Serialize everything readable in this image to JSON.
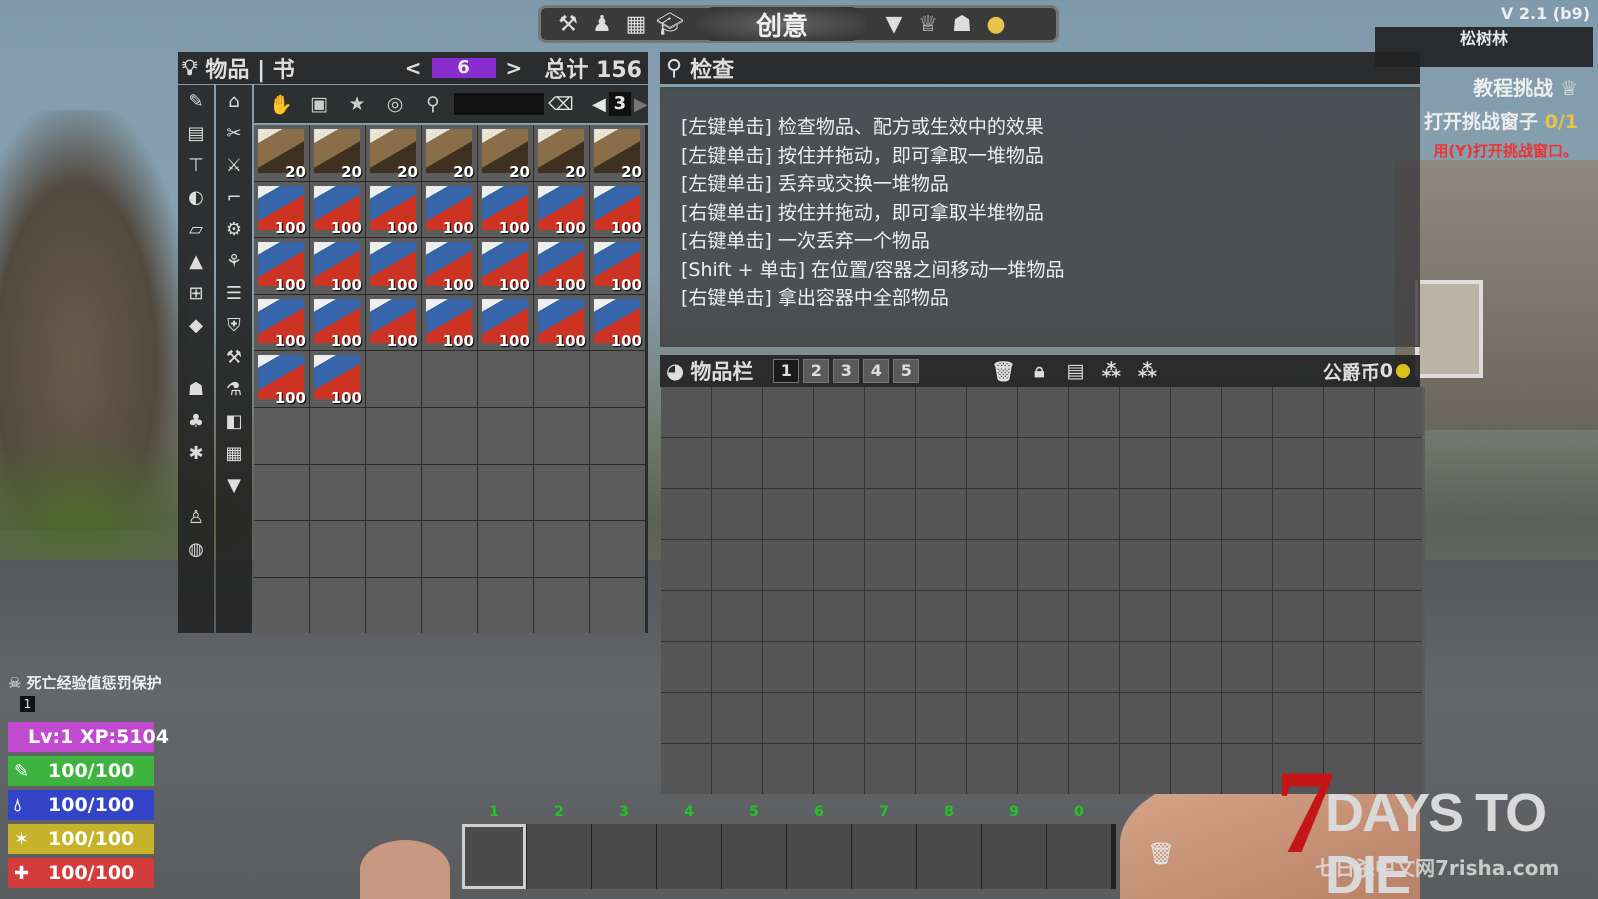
{
  "top_toolbar": {
    "mode_label": "创意",
    "left_icons": [
      "crafting-hammer-icon",
      "character-icon",
      "map-icon",
      "skills-icon"
    ],
    "right_icons": [
      "challenges-icon",
      "trophy-icon",
      "players-icon",
      "quest-bulb-icon"
    ]
  },
  "version": "V 2.1 (b9)",
  "biome": "松树林",
  "challenge": {
    "title": "教程挑战",
    "objective_prefix": "打开挑战窗子",
    "progress": "0/1",
    "hint": "用(Y)打开挑战窗口。"
  },
  "inventory": {
    "title": "物品 | 书",
    "page": "6",
    "total": "总计 156",
    "subpage": "3",
    "prev": "<",
    "next": ">",
    "items": [
      {
        "count": "20",
        "style": "a"
      },
      {
        "count": "20",
        "style": "a"
      },
      {
        "count": "20",
        "style": "a"
      },
      {
        "count": "20",
        "style": "a"
      },
      {
        "count": "20",
        "style": "a"
      },
      {
        "count": "20",
        "style": "a"
      },
      {
        "count": "20",
        "style": "a"
      },
      {
        "count": "100",
        "style": "b"
      },
      {
        "count": "100",
        "style": "b"
      },
      {
        "count": "100",
        "style": "b"
      },
      {
        "count": "100",
        "style": "b"
      },
      {
        "count": "100",
        "style": "b"
      },
      {
        "count": "100",
        "style": "b"
      },
      {
        "count": "100",
        "style": "b"
      },
      {
        "count": "100",
        "style": "b"
      },
      {
        "count": "100",
        "style": "b"
      },
      {
        "count": "100",
        "style": "b"
      },
      {
        "count": "100",
        "style": "b"
      },
      {
        "count": "100",
        "style": "b"
      },
      {
        "count": "100",
        "style": "b"
      },
      {
        "count": "100",
        "style": "b"
      },
      {
        "count": "100",
        "style": "b"
      },
      {
        "count": "100",
        "style": "b"
      },
      {
        "count": "100",
        "style": "b"
      },
      {
        "count": "100",
        "style": "b"
      },
      {
        "count": "100",
        "style": "b"
      },
      {
        "count": "100",
        "style": "b"
      },
      {
        "count": "100",
        "style": "b"
      },
      {
        "count": "100",
        "style": "b"
      },
      {
        "count": "100",
        "style": "b"
      }
    ],
    "total_cells": 63
  },
  "inspect": {
    "title": "检查",
    "lines": [
      "[左键单击] 检查物品、配方或生效中的效果",
      "[左键单击] 按住并拖动，即可拿取一堆物品",
      "[左键单击] 丢弃或交换一堆物品",
      "[右键单击] 按住并拖动，即可拿取半堆物品",
      "[右键单击] 一次丢弃一个物品",
      "[Shift + 单击] 在位置/容器之间移动一堆物品",
      "[右键单击] 拿出容器中全部物品"
    ]
  },
  "backpack": {
    "title": "物品栏",
    "tabs": [
      "1",
      "2",
      "3",
      "4",
      "5"
    ],
    "active_tab": 0,
    "coins_label": "公爵币",
    "coins": "0",
    "cells": 120
  },
  "toolbelt": {
    "numbers": [
      "1",
      "2",
      "3",
      "4",
      "5",
      "6",
      "7",
      "8",
      "9",
      "0"
    ],
    "selected": 0
  },
  "player": {
    "death_protection": "死亡经验值惩罚保护",
    "death_count": "1",
    "level": "Lv:1",
    "xp": "XP:5104",
    "health": "100/100",
    "water": "100/100",
    "stamina": "100/100",
    "food": "100/100"
  },
  "logo": {
    "number": "7",
    "text": "DAYS TO DIE",
    "watermark": "七日杀中文网7risha.com"
  }
}
